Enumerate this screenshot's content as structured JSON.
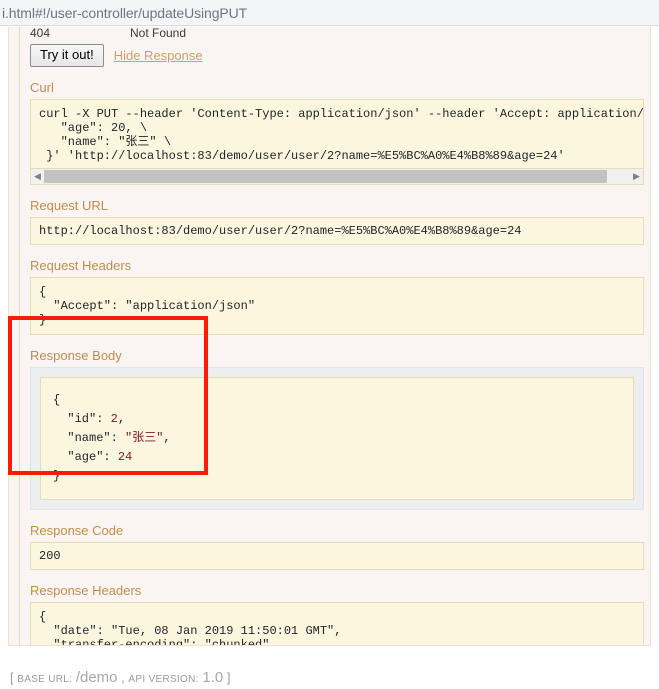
{
  "browser": {
    "url": "i.html#!/user-controller/updateUsingPUT"
  },
  "operation": {
    "response_row": {
      "code": "404",
      "reason": "Not Found"
    },
    "try_it_out_label": "Try it out!",
    "hide_response_label": "Hide Response",
    "sections": {
      "curl": {
        "title": "Curl",
        "content": "curl -X PUT --header 'Content-Type: application/json' --header 'Accept: application/json' -d '\n   \"age\": 20, \\\n   \"name\": \"张三\" \\\n }' 'http://localhost:83/demo/user/user/2?name=%E5%BC%A0%E4%B8%89&age=24'"
      },
      "request_url": {
        "title": "Request URL",
        "content": "http://localhost:83/demo/user/user/2?name=%E5%BC%A0%E4%B8%89&age=24"
      },
      "request_headers": {
        "title": "Request Headers",
        "content": "{\n  \"Accept\": \"application/json\"\n}"
      },
      "response_body": {
        "title": "Response Body",
        "lines": [
          "{",
          "  \"id\": 2,",
          "  \"name\": \"张三\",",
          "  \"age\": 24",
          "}"
        ]
      },
      "response_code": {
        "title": "Response Code",
        "content": "200"
      },
      "response_headers": {
        "title": "Response Headers",
        "content": "{\n  \"date\": \"Tue, 08 Jan 2019 11:50:01 GMT\",\n  \"transfer-encoding\": \"chunked\",\n  \"content-type\": \"application/json;charset=UTF-8\"\n}"
      }
    },
    "scrollbar": {
      "left_arrow": "◀",
      "right_arrow": "▶"
    }
  },
  "footer": {
    "open_bracket": "[",
    "base_url_label": "base url:",
    "base_url_value": "/demo",
    "comma": ",",
    "api_version_label": "api version:",
    "api_version_value": "1.0",
    "close_bracket": "]"
  },
  "colors": {
    "annotation": "#fc1b07",
    "section_title": "#c08d4e",
    "code_bg": "#fcf6df",
    "panel_bg": "#faf5f2"
  }
}
